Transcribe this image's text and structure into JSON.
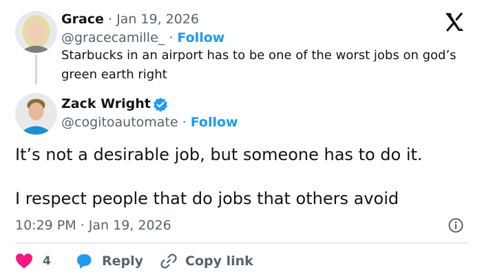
{
  "reply_to": {
    "name": "Grace",
    "separator": "·",
    "date": "Jan 19, 2026",
    "handle": "@gracecamille_",
    "follow": "Follow",
    "text": "Starbucks in an airport has to be one of the worst jobs on god’s green earth right"
  },
  "tweet": {
    "name": "Zack Wright",
    "verified": true,
    "handle": "@cogitoautomate",
    "follow": "Follow",
    "line1": "It’s not a desirable job, but someone has to do it.",
    "line2": "I respect people that do jobs that others avoid",
    "time": "10:29 PM",
    "date": "Jan 19, 2026"
  },
  "actions": {
    "likes": "4",
    "reply": "Reply",
    "copy_link": "Copy link"
  },
  "icons": [
    "x-logo-icon",
    "verified-badge-icon",
    "info-icon",
    "heart-icon",
    "reply-bubble-icon",
    "link-icon"
  ],
  "colors": {
    "accent": "#1d9bf0",
    "heart": "#f91880",
    "text": "#0f1419",
    "secondary": "#536471"
  }
}
